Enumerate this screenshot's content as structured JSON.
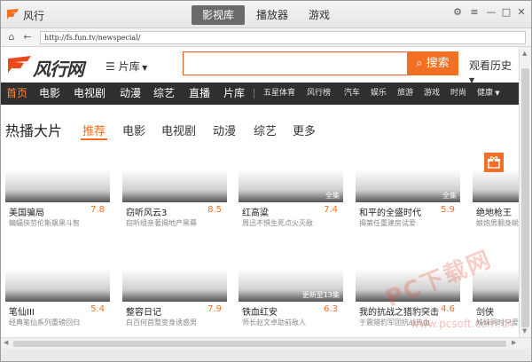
{
  "app": {
    "name": "风行"
  },
  "top_tabs": [
    {
      "label": "影视库",
      "active": true
    },
    {
      "label": "播放器",
      "active": false
    },
    {
      "label": "游戏",
      "active": false
    }
  ],
  "window_controls": {
    "settings": "⚙",
    "menu": "≡",
    "minimize": "—",
    "maximize": "□",
    "close": "✕"
  },
  "address": {
    "url": "http://fs.fun.tv/newspecial/"
  },
  "site": {
    "logo_text": "风行网",
    "library_menu": "片库",
    "search_button": "搜索",
    "search_placeholder": "",
    "history": "观看历史"
  },
  "nav": {
    "main": [
      "首页",
      "电影",
      "电视剧",
      "动漫",
      "综艺",
      "直播",
      "片库"
    ],
    "sub": [
      "五星体育",
      "风行榜",
      "汽车",
      "娱乐",
      "旅游",
      "游戏",
      "时尚",
      "健康"
    ]
  },
  "section": {
    "title": "热播大片",
    "filters": [
      "推荐",
      "电影",
      "电视剧",
      "动漫",
      "综艺",
      "更多"
    ]
  },
  "cards": [
    {
      "title": "美国骗局",
      "score": "7.8",
      "desc": "蝙蝠侠劳伦斯飙黑斗智",
      "badge": ""
    },
    {
      "title": "窃听风云3",
      "score": "8.5",
      "desc": "窃听组亲著揭地产黑幕",
      "badge": ""
    },
    {
      "title": "红高粱",
      "score": "7.4",
      "desc": "周迅不惧生死点火灭敌",
      "badge": "全集"
    },
    {
      "title": "和平的全盛时代",
      "score": "5.9",
      "desc": "揭第任重建房试爱",
      "badge": "全集"
    },
    {
      "title": "绝地枪王",
      "score": "",
      "desc": "娘炮男翻身蜕变",
      "badge": ""
    },
    {
      "title": "笔仙III",
      "score": "5.4",
      "desc": "经典笔仙系列重磅回归",
      "badge": ""
    },
    {
      "title": "整容日记",
      "score": "7.9",
      "desc": "白百何首整变身诱惑男",
      "badge": ""
    },
    {
      "title": "铁血红安",
      "score": "6.3",
      "desc": "师长赵文卓助前敌人",
      "badge": "更新至13集"
    },
    {
      "title": "我的抗战之猎豹突击",
      "score": "4.6",
      "desc": "于震猎豹军团抗战热血",
      "badge": ""
    },
    {
      "title": "剑侠",
      "score": "",
      "desc": "姊妹同时只爱一人",
      "badge": ""
    }
  ],
  "watermark": {
    "main": "PC下载网",
    "sub": "www.pcsoft.com.cn"
  },
  "colors": {
    "accent": "#f36f21",
    "nav_bg": "#2f2f2f",
    "active_tab": "#6a6a6a"
  }
}
